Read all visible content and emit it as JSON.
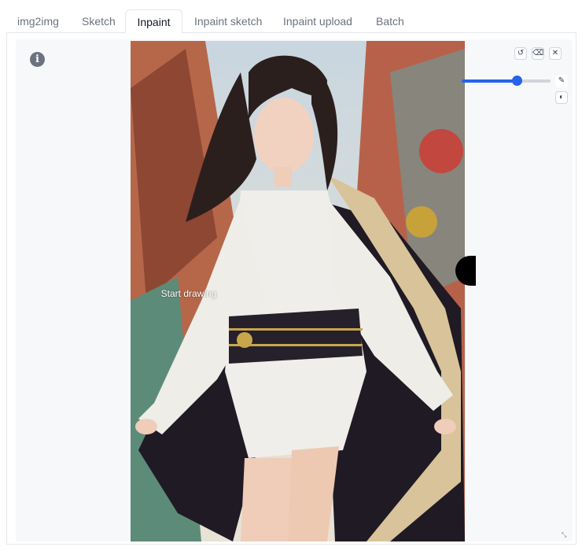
{
  "tabs": [
    {
      "label": "img2img",
      "active": false
    },
    {
      "label": "Sketch",
      "active": false
    },
    {
      "label": "Inpaint",
      "active": true
    },
    {
      "label": "Inpaint sketch",
      "active": false
    },
    {
      "label": "Inpaint upload",
      "active": false
    },
    {
      "label": "Batch",
      "active": false
    }
  ],
  "canvas": {
    "overlay_text": "Start drawing",
    "info_icon": "info-icon",
    "resize_icon": "resize-corner-icon"
  },
  "toolbar": {
    "undo_icon": "undo-icon",
    "eraser_icon": "eraser-icon",
    "close_icon": "close-icon",
    "brush_icon": "brush-icon",
    "color_icon": "palette-icon",
    "brush_size_fraction": 0.62
  },
  "colors": {
    "accent": "#2563eb",
    "tab_active_text": "#111827",
    "tab_inactive_text": "#6b7280"
  }
}
